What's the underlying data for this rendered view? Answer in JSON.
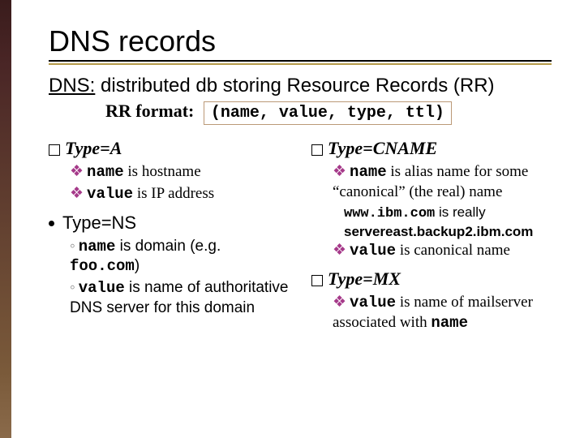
{
  "title": "DNS records",
  "sub_u": "DNS:",
  "sub_rest": " distributed db storing Resource Records (RR)",
  "rr_label": "RR format:",
  "rr_box": "(name, value, type, ttl)",
  "left": {
    "a": {
      "heading": "Type=A",
      "l1a": "name",
      "l1b": " is hostname",
      "l2a": "value",
      "l2b": " is IP address"
    },
    "ns": {
      "heading": "Type=NS",
      "l1a": "name",
      "l1b": " is domain (e.g. ",
      "l1c": "foo.com",
      "l1d": ")",
      "l2a": "value",
      "l2b": " is name of authoritative DNS server for this domain"
    }
  },
  "right": {
    "cname": {
      "heading": "Type=CNAME",
      "l1a": "name",
      "l1b": " is alias name for some “canonical” (the real) name",
      "ex1a": "www.ibm.com",
      "ex1b": " is really",
      "ex2": "servereast.backup2.ibm.com",
      "l2a": "value",
      "l2b": " is canonical name"
    },
    "mx": {
      "heading": "Type=MX",
      "l1a": "value",
      "l1b": " is name of mailserver associated with ",
      "l1c": "name"
    }
  }
}
